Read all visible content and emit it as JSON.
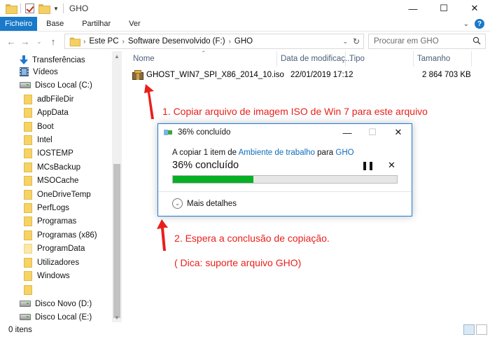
{
  "window": {
    "title": "GHO",
    "controls": {
      "minimize": "—",
      "maximize": "☐",
      "close": "✕"
    }
  },
  "ribbon": {
    "tabs": [
      "Ficheiro",
      "Base",
      "Partilhar",
      "Ver"
    ],
    "active_tab": "Ficheiro",
    "accent": "#1979ca"
  },
  "address": {
    "segments": [
      "Este PC",
      "Software Desenvolvido (F:)",
      "GHO"
    ],
    "search_placeholder": "Procurar em GHO"
  },
  "sidebar": {
    "quick_access": [
      {
        "label": "Transferências",
        "icon": "download-arrow-icon"
      },
      {
        "label": "Vídeos",
        "icon": "film-icon"
      }
    ],
    "drive_c": "Disco Local (C:)",
    "folders": [
      "adbFileDir",
      "AppData",
      "Boot",
      "Intel",
      "IOSTEMP",
      "MCsBackup",
      "MSOCache",
      "OneDriveTemp",
      "PerfLogs",
      "Programas",
      "Programas (x86)",
      "ProgramData",
      "Utilizadores",
      "Windows",
      ""
    ],
    "drive_d": "Disco Novo (D:)",
    "drive_e": "Disco Local (E:)"
  },
  "columns": {
    "name": "Nome",
    "date": "Data de modificaç...",
    "type": "Tipo",
    "size": "Tamanho"
  },
  "files": [
    {
      "name": "GHOST_WIN7_SPI_X86_2014_10.iso",
      "date": "22/01/2019 17:12",
      "type": "",
      "size": "2 864 703 KB"
    }
  ],
  "annotations": {
    "step1": "1. Copiar arquivo de imagem ISO de Win 7 para este arquivo",
    "step2": "2. Espera a conclusão de copiação.",
    "tip": "( Dica: suporte arquivo GHO)",
    "color": "#e8201c"
  },
  "dialog": {
    "title": "36% concluído",
    "line_prefix": "A copiar 1 item de ",
    "source": "Ambiente de trabalho",
    "line_mid": " para ",
    "destination": "GHO",
    "status": "36% concluído",
    "progress_percent": 36,
    "more_details": "Mais detalhes",
    "pause_glyph": "❚❚",
    "cancel_glyph": "✕"
  },
  "status_bar": {
    "items": "0 itens"
  }
}
